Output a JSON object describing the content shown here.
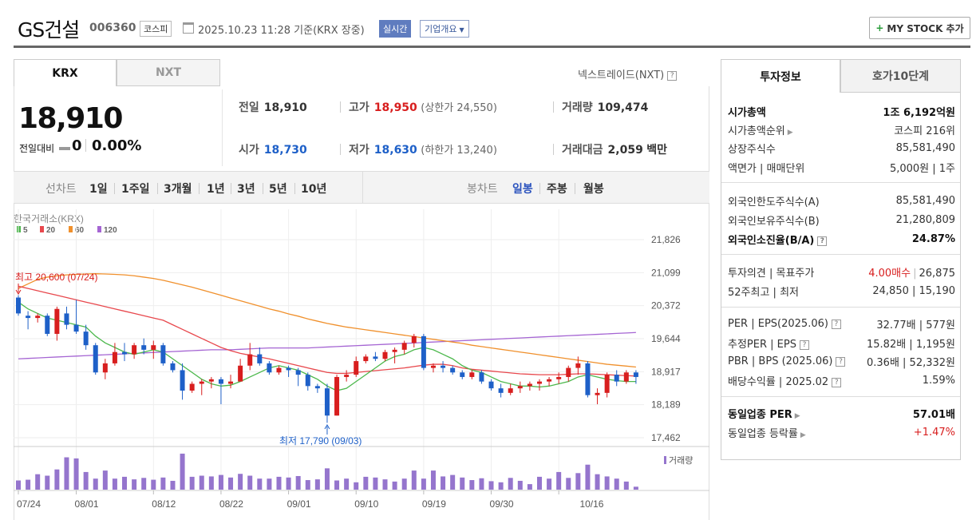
{
  "header": {
    "company": "GS건설",
    "code": "006360",
    "market": "코스피",
    "datetime": "2025.10.23 11:28  기준(KRX 장중)",
    "realtime": "실시간",
    "overview": "기업개요",
    "mystock": "MY STOCK 추가"
  },
  "tabs": {
    "krx": "KRX",
    "nxt": "NXT",
    "nxt_link": "넥스트레이드(NXT)"
  },
  "quote": {
    "price": "18,910",
    "change_label": "전일대비",
    "change": "0",
    "change_pct": "0.00%",
    "prev_label": "전일",
    "prev": "18,910",
    "open_label": "시가",
    "open": "18,730",
    "high_label": "고가",
    "high": "18,950",
    "upper_limit": "(상한가 24,550)",
    "low_label": "저가",
    "low": "18,630",
    "lower_limit": "(하한가 13,240)",
    "volume_label": "거래량",
    "volume": "109,474",
    "amount_label": "거래대금",
    "amount": "2,059",
    "amount_unit": "백만"
  },
  "period_bar": {
    "line_label": "선차트",
    "periods": [
      "1일",
      "1주일",
      "3개월",
      "1년",
      "3년",
      "5년",
      "10년"
    ],
    "candle_label": "봉차트",
    "candles": [
      "일봉",
      "주봉",
      "월봉"
    ],
    "active_candle": "일봉"
  },
  "chart_data": {
    "type": "candlestick",
    "title": "한국거래소(KRX)",
    "legend": [
      {
        "name": "5",
        "color": "#4cb84c"
      },
      {
        "name": "20",
        "color": "#e8484d"
      },
      {
        "name": "60",
        "color": "#f0902c"
      },
      {
        "name": "120",
        "color": "#a565d3"
      }
    ],
    "y_ticks": [
      "21,826",
      "21,099",
      "20,372",
      "19,644",
      "18,917",
      "18,189",
      "17,462"
    ],
    "ylim": [
      17462,
      21826
    ],
    "x_ticks": [
      "07/24",
      "08/01",
      "08/12",
      "08/22",
      "09/01",
      "09/10",
      "09/19",
      "09/30",
      "10/16"
    ],
    "high_note": "최고 20,600 (07/24)",
    "low_note": "최저 17,790 (09/03)",
    "volume_label": "거래량",
    "candles": [
      [
        20550,
        20600,
        20150,
        20200
      ],
      [
        20150,
        20250,
        19850,
        20100
      ],
      [
        20100,
        20200,
        20000,
        20150
      ],
      [
        20150,
        20200,
        19700,
        19750
      ],
      [
        19750,
        20350,
        19600,
        20300
      ],
      [
        20200,
        20350,
        19850,
        19950
      ],
      [
        19950,
        20500,
        19750,
        19800
      ],
      [
        19800,
        19950,
        19400,
        19500
      ],
      [
        19500,
        19550,
        18850,
        18900
      ],
      [
        18900,
        19200,
        18750,
        19100
      ],
      [
        19100,
        19550,
        19050,
        19350
      ],
      [
        19350,
        19550,
        19150,
        19300
      ],
      [
        19300,
        19550,
        19200,
        19500
      ],
      [
        19500,
        19650,
        19300,
        19400
      ],
      [
        19400,
        19600,
        19200,
        19500
      ],
      [
        19500,
        19550,
        19050,
        19100
      ],
      [
        19100,
        19150,
        18900,
        18950
      ],
      [
        18950,
        19100,
        18300,
        18500
      ],
      [
        18500,
        18700,
        18450,
        18650
      ],
      [
        18650,
        18750,
        18400,
        18700
      ],
      [
        18700,
        18800,
        18550,
        18750
      ],
      [
        18750,
        18800,
        18200,
        18650
      ],
      [
        18650,
        18850,
        18550,
        18700
      ],
      [
        18700,
        19200,
        18700,
        19050
      ],
      [
        19050,
        19550,
        18950,
        19300
      ],
      [
        19300,
        19450,
        19050,
        19100
      ],
      [
        19100,
        19150,
        18850,
        18900
      ],
      [
        18900,
        19050,
        18850,
        19000
      ],
      [
        19000,
        19050,
        18800,
        18950
      ],
      [
        18950,
        19000,
        18600,
        18850
      ],
      [
        18850,
        18900,
        18500,
        18600
      ],
      [
        18600,
        18650,
        18450,
        18550
      ],
      [
        18550,
        18650,
        17790,
        17950
      ],
      [
        17950,
        18850,
        17950,
        18800
      ],
      [
        18800,
        18950,
        18700,
        18850
      ],
      [
        18850,
        19250,
        18800,
        19150
      ],
      [
        19150,
        19300,
        19100,
        19250
      ],
      [
        19250,
        19350,
        19150,
        19200
      ],
      [
        19200,
        19400,
        19150,
        19350
      ],
      [
        19350,
        19450,
        19100,
        19400
      ],
      [
        19400,
        19600,
        19300,
        19550
      ],
      [
        19550,
        19750,
        19450,
        19700
      ],
      [
        19700,
        19750,
        18950,
        19000
      ],
      [
        19000,
        19100,
        18900,
        19050
      ],
      [
        19050,
        19150,
        18900,
        19000
      ],
      [
        19000,
        19050,
        18850,
        18900
      ],
      [
        18900,
        18950,
        18750,
        18800
      ],
      [
        18800,
        18950,
        18750,
        18900
      ],
      [
        18900,
        18950,
        18650,
        18700
      ],
      [
        18700,
        18750,
        18500,
        18550
      ],
      [
        18550,
        18650,
        18350,
        18450
      ],
      [
        18450,
        18650,
        18400,
        18550
      ],
      [
        18550,
        18700,
        18450,
        18600
      ],
      [
        18600,
        18700,
        18500,
        18650
      ],
      [
        18650,
        18750,
        18500,
        18700
      ],
      [
        18700,
        18800,
        18600,
        18750
      ],
      [
        18750,
        18900,
        18650,
        18800
      ],
      [
        18800,
        19050,
        18700,
        19000
      ],
      [
        19000,
        19250,
        18850,
        19100
      ],
      [
        19100,
        19150,
        18350,
        18400
      ],
      [
        18400,
        18550,
        18200,
        18450
      ],
      [
        18450,
        18900,
        18350,
        18850
      ],
      [
        18850,
        18950,
        18600,
        18700
      ],
      [
        18700,
        18950,
        18650,
        18900
      ],
      [
        18900,
        18950,
        18650,
        18800
      ]
    ],
    "ma5": [
      20450,
      20300,
      20200,
      20100,
      20050,
      20000,
      19950,
      19900,
      19700,
      19550,
      19450,
      19350,
      19300,
      19350,
      19400,
      19350,
      19200,
      19050,
      18900,
      18750,
      18650,
      18600,
      18620,
      18700,
      18800,
      18900,
      19000,
      19050,
      19000,
      18950,
      18850,
      18750,
      18600,
      18500,
      18550,
      18700,
      18850,
      19000,
      19150,
      19250,
      19300,
      19400,
      19450,
      19400,
      19300,
      19200,
      19050,
      18950,
      18900,
      18800,
      18700,
      18650,
      18600,
      18600,
      18580,
      18600,
      18650,
      18700,
      18800,
      18850,
      18800,
      18750,
      18720,
      18700,
      18700
    ],
    "ma20": [
      20800,
      20750,
      20700,
      20650,
      20600,
      20550,
      20500,
      20450,
      20400,
      20350,
      20300,
      20250,
      20200,
      20150,
      20100,
      20050,
      19950,
      19850,
      19750,
      19650,
      19550,
      19450,
      19380,
      19320,
      19280,
      19240,
      19200,
      19150,
      19100,
      19050,
      19000,
      18950,
      18900,
      18880,
      18880,
      18900,
      18920,
      18940,
      18960,
      18980,
      19000,
      19030,
      19060,
      19080,
      19080,
      19050,
      19000,
      18970,
      18950,
      18930,
      18910,
      18890,
      18870,
      18860,
      18850,
      18850,
      18850,
      18860,
      18870,
      18870,
      18860,
      18850,
      18840,
      18830,
      18820
    ],
    "ma60": [
      20750,
      20850,
      20950,
      21000,
      21030,
      21050,
      21060,
      21070,
      21075,
      21070,
      21060,
      21050,
      21030,
      21000,
      20970,
      20930,
      20880,
      20830,
      20780,
      20720,
      20660,
      20600,
      20540,
      20480,
      20420,
      20360,
      20300,
      20250,
      20190,
      20140,
      20080,
      20030,
      19980,
      19940,
      19900,
      19870,
      19840,
      19810,
      19780,
      19750,
      19720,
      19690,
      19660,
      19630,
      19600,
      19570,
      19540,
      19500,
      19470,
      19440,
      19410,
      19380,
      19350,
      19320,
      19290,
      19260,
      19230,
      19200,
      19170,
      19140,
      19110,
      19080,
      19060,
      19040,
      19020
    ],
    "ma120": [
      19200,
      19210,
      19220,
      19230,
      19240,
      19250,
      19260,
      19270,
      19280,
      19290,
      19300,
      19310,
      19320,
      19330,
      19340,
      19350,
      19360,
      19370,
      19380,
      19390,
      19400,
      19400,
      19400,
      19410,
      19420,
      19430,
      19440,
      19440,
      19440,
      19440,
      19440,
      19450,
      19460,
      19470,
      19480,
      19490,
      19500,
      19510,
      19520,
      19530,
      19540,
      19550,
      19560,
      19570,
      19580,
      19590,
      19600,
      19610,
      19620,
      19630,
      19640,
      19650,
      19660,
      19670,
      19680,
      19690,
      19700,
      19710,
      19720,
      19730,
      19740,
      19750,
      19760,
      19770,
      19780
    ],
    "volumes": [
      0.25,
      0.27,
      0.42,
      0.38,
      0.55,
      0.88,
      0.85,
      0.48,
      0.3,
      0.52,
      0.3,
      0.35,
      0.28,
      0.32,
      0.27,
      0.33,
      0.24,
      0.98,
      0.35,
      0.38,
      0.36,
      0.4,
      0.33,
      0.43,
      0.38,
      0.3,
      0.3,
      0.35,
      0.33,
      0.37,
      0.26,
      0.28,
      0.58,
      0.25,
      0.3,
      0.2,
      0.35,
      0.33,
      0.28,
      0.22,
      0.3,
      0.52,
      0.3,
      0.52,
      0.36,
      0.4,
      0.33,
      0.26,
      0.31,
      0.23,
      0.2,
      0.32,
      0.24,
      0.15,
      0.35,
      0.3,
      0.48,
      0.32,
      0.45,
      0.68,
      0.42,
      0.36,
      0.3,
      0.22,
      0.08
    ]
  },
  "right_panel": {
    "tabs": [
      "투자정보",
      "호가10단계"
    ],
    "rows": [
      {
        "k": "시가총액",
        "v": "1조 6,192억원",
        "bold": true
      },
      {
        "k": "시가총액순위",
        "v": "코스피 216위"
      },
      {
        "k": "상장주식수",
        "v": "85,581,490"
      },
      {
        "k": "액면가 | 매매단위",
        "v": "5,000원 | 1주"
      },
      {
        "k": "외국인한도주식수(A)",
        "v": "85,581,490"
      },
      {
        "k": "외국인보유주식수(B)",
        "v": "21,280,809"
      },
      {
        "k": "외국인소진율(B/A)",
        "v": "24.87%",
        "bold": true
      },
      {
        "k": "투자의견 | 목표주가",
        "v1": "4.00매수",
        "v2": "26,875"
      },
      {
        "k": "52주최고 | 최저",
        "v": "24,850 | 15,190"
      },
      {
        "k": "PER | EPS(2025.06)",
        "v": "32.77배 | 577원"
      },
      {
        "k": "추정PER | EPS",
        "v": "15.82배 | 1,195원"
      },
      {
        "k": "PBR | BPS (2025.06)",
        "v": "0.36배 | 52,332원"
      },
      {
        "k": "배당수익률 | 2025.02",
        "v": "1.59%"
      },
      {
        "k": "동일업종 PER",
        "v": "57.01배",
        "bold": true
      },
      {
        "k": "동일업종 등락률",
        "v": "+1.47%"
      }
    ]
  },
  "colors": {
    "up": "#d81e1e",
    "down": "#1e60c8",
    "accent": "#2a52be"
  }
}
